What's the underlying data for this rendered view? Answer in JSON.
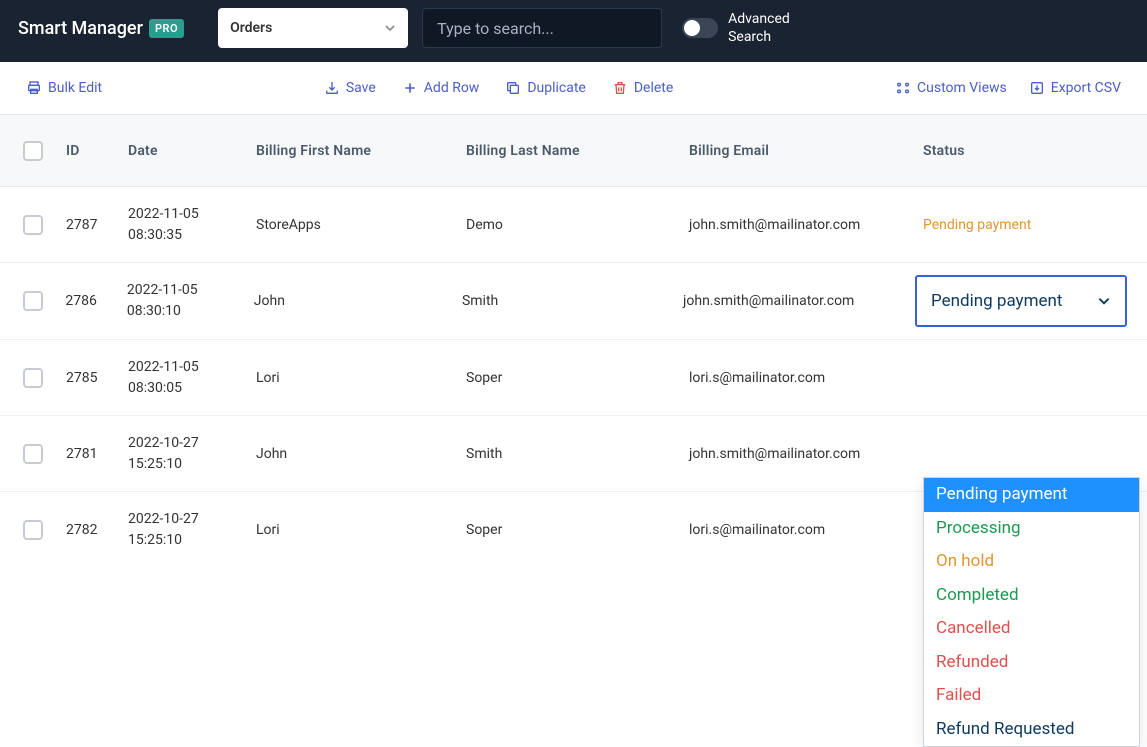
{
  "brand": {
    "name": "Smart Manager",
    "badge": "PRO"
  },
  "entity": {
    "selected": "Orders"
  },
  "search": {
    "placeholder": "Type to search..."
  },
  "advanced": {
    "line1": "Advanced",
    "line2": "Search"
  },
  "toolbar": {
    "bulk_edit": "Bulk Edit",
    "save": "Save",
    "add_row": "Add Row",
    "duplicate": "Duplicate",
    "delete": "Delete",
    "custom_views": "Custom Views",
    "export_csv": "Export CSV"
  },
  "columns": {
    "id": "ID",
    "date": "Date",
    "fname": "Billing First Name",
    "lname": "Billing Last Name",
    "email": "Billing Email",
    "status": "Status"
  },
  "rows": [
    {
      "id": "2787",
      "date_d": "2022-11-05",
      "date_t": "08:30:35",
      "fname": "StoreApps",
      "lname": "Demo",
      "email": "john.smith@mailinator.com",
      "status": "Pending payment"
    },
    {
      "id": "2786",
      "date_d": "2022-11-05",
      "date_t": "08:30:10",
      "fname": "John",
      "lname": "Smith",
      "email": "john.smith@mailinator.com",
      "status": "Pending payment"
    },
    {
      "id": "2785",
      "date_d": "2022-11-05",
      "date_t": "08:30:05",
      "fname": "Lori",
      "lname": "Soper",
      "email": "lori.s@mailinator.com",
      "status": ""
    },
    {
      "id": "2781",
      "date_d": "2022-10-27",
      "date_t": "15:25:10",
      "fname": "John",
      "lname": "Smith",
      "email": "john.smith@mailinator.com",
      "status": ""
    },
    {
      "id": "2782",
      "date_d": "2022-10-27",
      "date_t": "15:25:10",
      "fname": "Lori",
      "lname": "Soper",
      "email": "lori.s@mailinator.com",
      "status": ""
    }
  ],
  "status_dropdown": {
    "selected": "Pending payment",
    "options": [
      {
        "label": "Pending payment",
        "cls": "sel"
      },
      {
        "label": "Processing",
        "cls": "c-green"
      },
      {
        "label": "On hold",
        "cls": "c-orange"
      },
      {
        "label": "Completed",
        "cls": "c-green"
      },
      {
        "label": "Cancelled",
        "cls": "c-red"
      },
      {
        "label": "Refunded",
        "cls": "c-red"
      },
      {
        "label": "Failed",
        "cls": "c-red"
      },
      {
        "label": "Refund Requested",
        "cls": "c-navy"
      }
    ]
  }
}
